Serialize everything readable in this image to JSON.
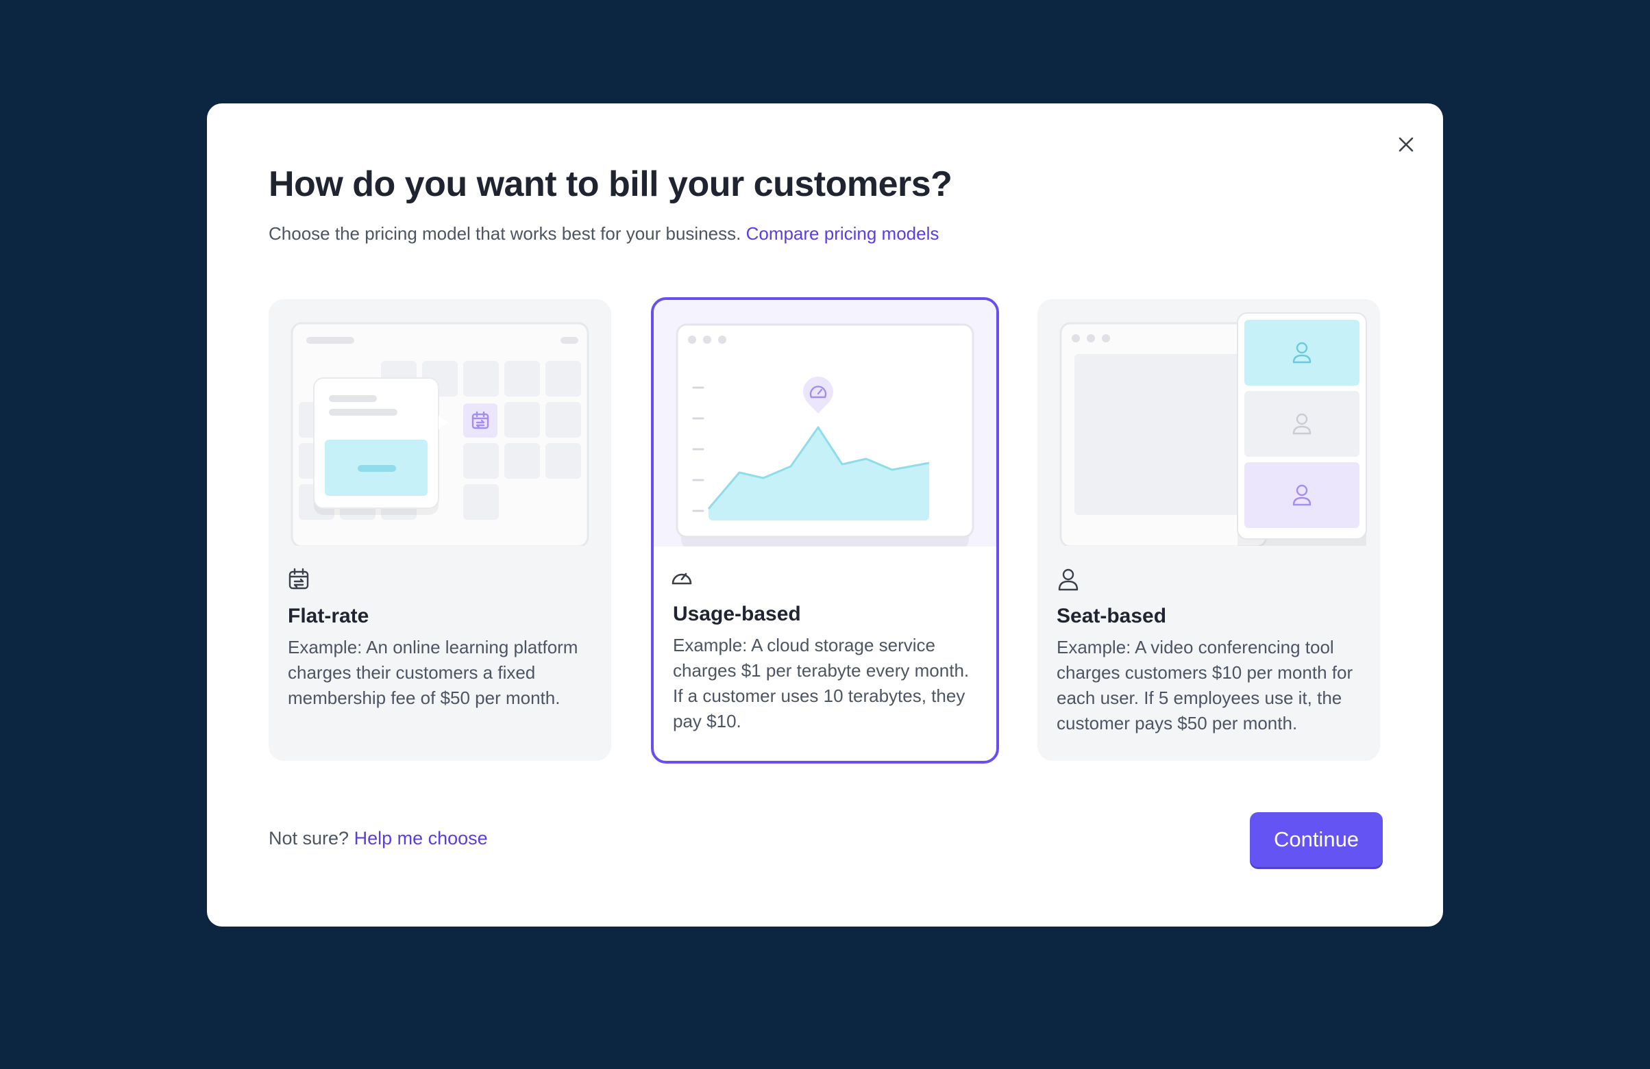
{
  "modal": {
    "title": "How do you want to bill your customers?",
    "subtitle": "Choose the pricing model that works best for your business.",
    "compare_link": "Compare pricing models",
    "close_icon": "close-icon"
  },
  "options": [
    {
      "icon": "calendar-repeat-icon",
      "title": "Flat-rate",
      "description": "Example: An online learning platform charges their customers a fixed membership fee of $50 per month.",
      "selected": false
    },
    {
      "icon": "gauge-icon",
      "title": "Usage-based",
      "description": "Example: A cloud storage service charges $1 per terabyte every month. If a customer uses 10 terabytes, they pay $10.",
      "selected": true
    },
    {
      "icon": "user-icon",
      "title": "Seat-based",
      "description": "Example: A video conferencing tool charges customers $10 per month for each user. If 5 employees use it, the customer pays $50 per month.",
      "selected": false
    }
  ],
  "footer": {
    "not_sure": "Not sure?",
    "help_link": "Help me choose",
    "continue_label": "Continue"
  },
  "colors": {
    "backdrop": "#0c2541",
    "accent": "#6554f4",
    "link": "#5a3de6",
    "selected_border": "#6a4ff0",
    "cyan_fill": "#c7f1f8"
  }
}
